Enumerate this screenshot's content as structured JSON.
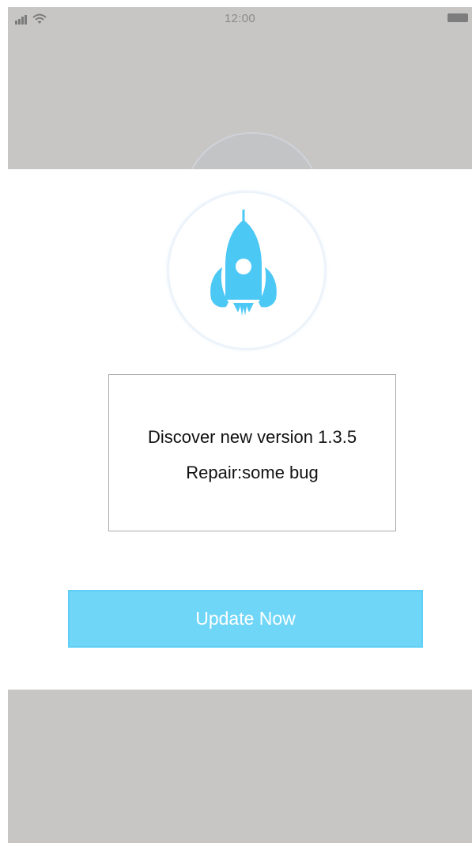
{
  "status_bar": {
    "time": "12:00"
  },
  "dialog": {
    "icon": "rocket-icon",
    "version_text": "Discover new version 1.3.5",
    "repair_text": "Repair:some bug",
    "update_button_label": "Update Now"
  },
  "colors": {
    "accent": "#70d6f8",
    "rocket": "#4cc8f5",
    "overlay": "#c7c6c5"
  }
}
